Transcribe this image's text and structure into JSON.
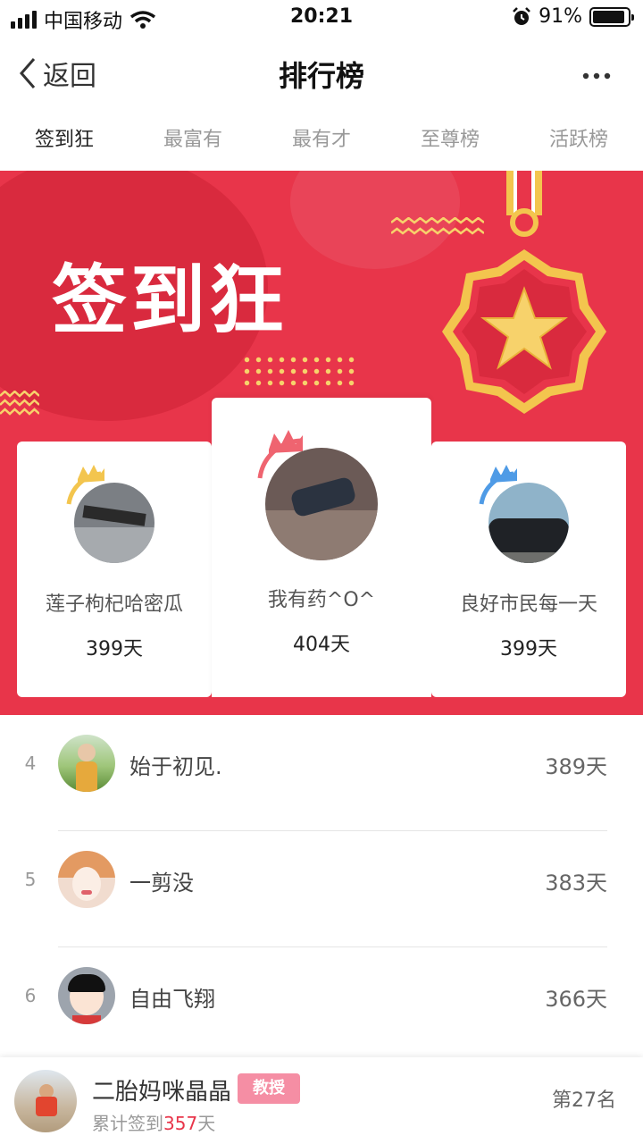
{
  "status_bar": {
    "carrier": "中国移动",
    "time": "20:21",
    "battery": "91%",
    "battery_level": 0.91
  },
  "nav": {
    "back_label": "返回",
    "title": "排行榜",
    "more_label": "•••"
  },
  "tabs": [
    {
      "label": "签到狂",
      "active": true
    },
    {
      "label": "最富有",
      "active": false
    },
    {
      "label": "最有才",
      "active": false
    },
    {
      "label": "至尊榜",
      "active": false
    },
    {
      "label": "活跃榜",
      "active": false
    }
  ],
  "banner": {
    "title": "签到狂",
    "accent": "#e8354a",
    "gold": "#f3c54e"
  },
  "podium": {
    "first": {
      "name": "我有药^O^",
      "days": "404天",
      "crown": "red-crown-icon"
    },
    "second": {
      "name": "莲子枸杞哈密瓜",
      "days": "399天",
      "crown": "gold-crown-icon"
    },
    "third": {
      "name": "良好市民每一天",
      "days": "399天",
      "crown": "blue-crown-icon"
    }
  },
  "list": [
    {
      "rank": "4",
      "name": "始于初见.",
      "days": "389天"
    },
    {
      "rank": "5",
      "name": "一剪没",
      "days": "383天"
    },
    {
      "rank": "6",
      "name": "自由飞翔",
      "days": "366天"
    }
  ],
  "me": {
    "name": "二胎妈咪晶晶",
    "badge": "教授",
    "prefix": "累计签到",
    "count": "357",
    "suffix": "天",
    "rank": "第27名"
  }
}
